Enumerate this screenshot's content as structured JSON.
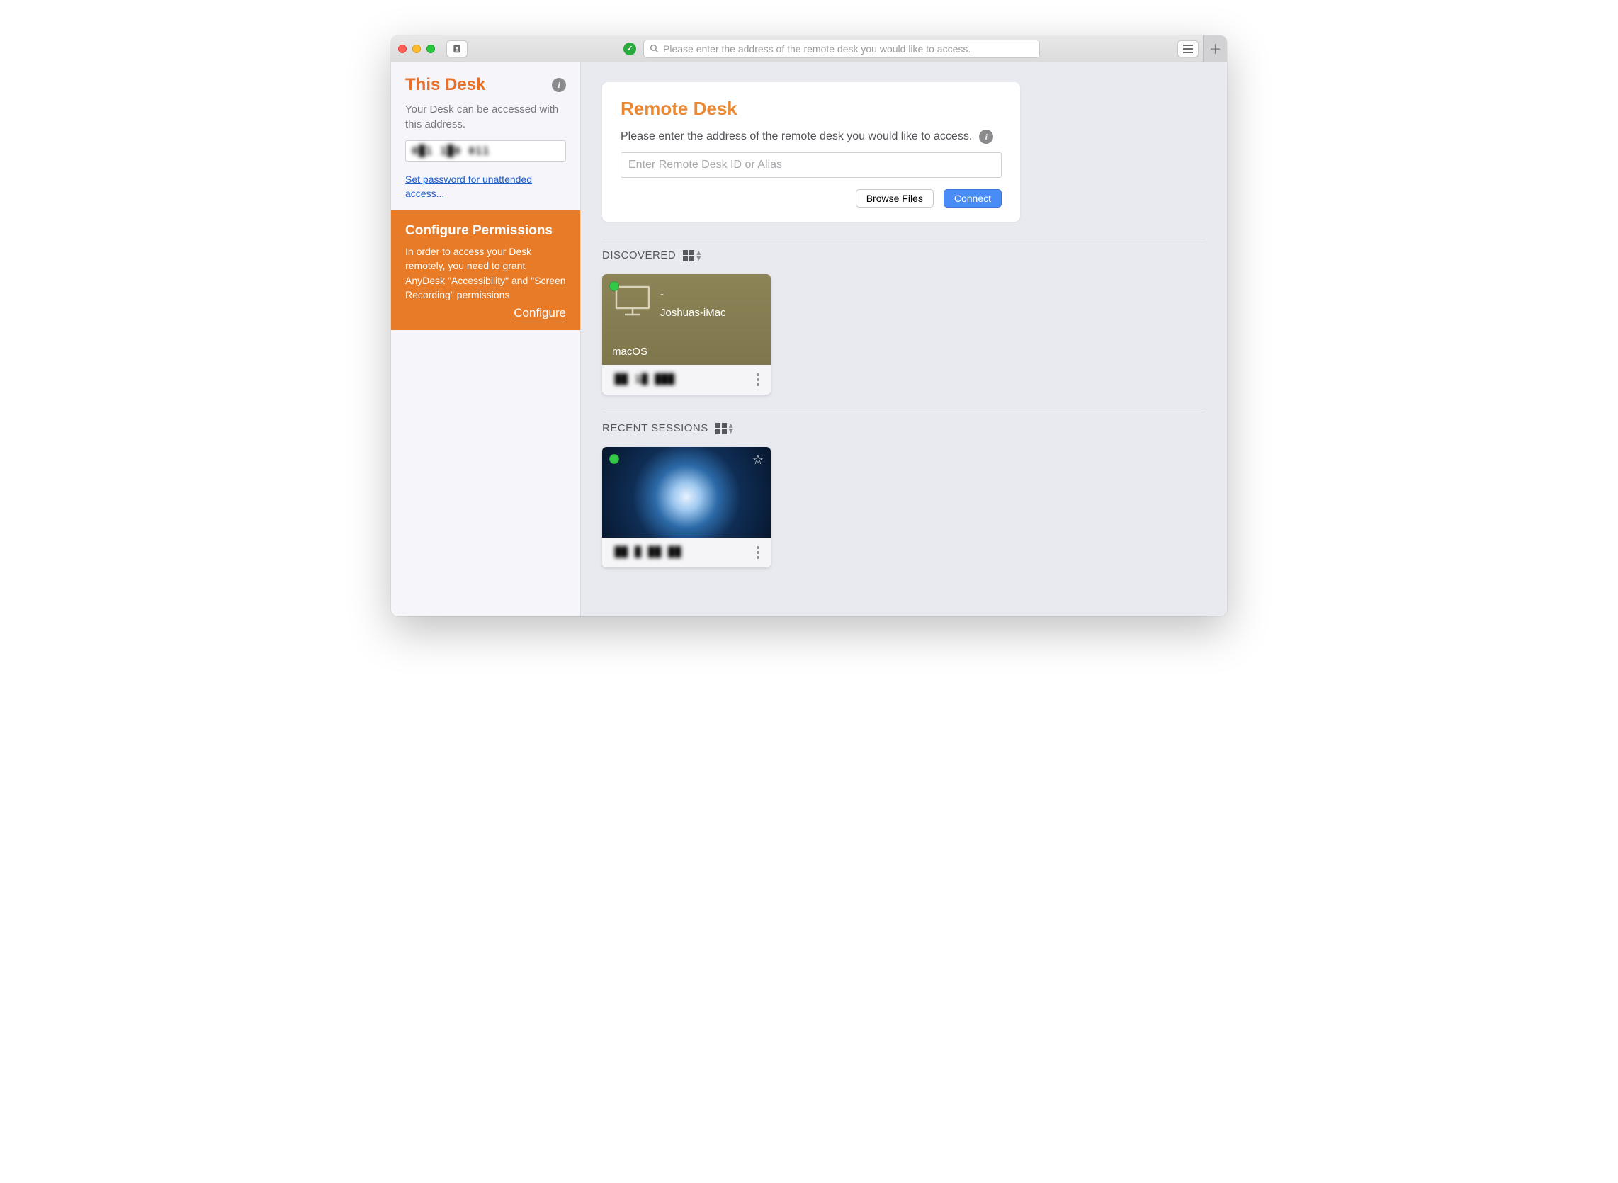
{
  "titlebar": {
    "search_placeholder": "Please enter the address of the remote desk you would like to access."
  },
  "sidebar": {
    "thisdesk_title": "This Desk",
    "thisdesk_sub": "Your Desk can be accessed with this address.",
    "address_masked": "0█1 1█0 011",
    "password_link": "Set password for unattended access...",
    "perm_title": "Configure Permissions",
    "perm_body": "In order to access your Desk remotely, you need to grant AnyDesk \"Accessibility\" and \"Screen Recording\" permissions",
    "perm_link": "Configure"
  },
  "remote": {
    "title": "Remote Desk",
    "subtitle": "Please enter the address of the remote desk you would like to access.",
    "input_placeholder": "Enter Remote Desk ID or Alias",
    "browse_label": "Browse Files",
    "connect_label": "Connect"
  },
  "sections": {
    "discovered_label": "DISCOVERED",
    "recent_label": "RECENT SESSIONS"
  },
  "discovered": [
    {
      "id_top": "-",
      "host": "Joshuas-iMac",
      "os": "macOS",
      "id_masked": "██ 1█ ███"
    }
  ],
  "recent": [
    {
      "id_masked": "██ █ ██ ██"
    }
  ]
}
